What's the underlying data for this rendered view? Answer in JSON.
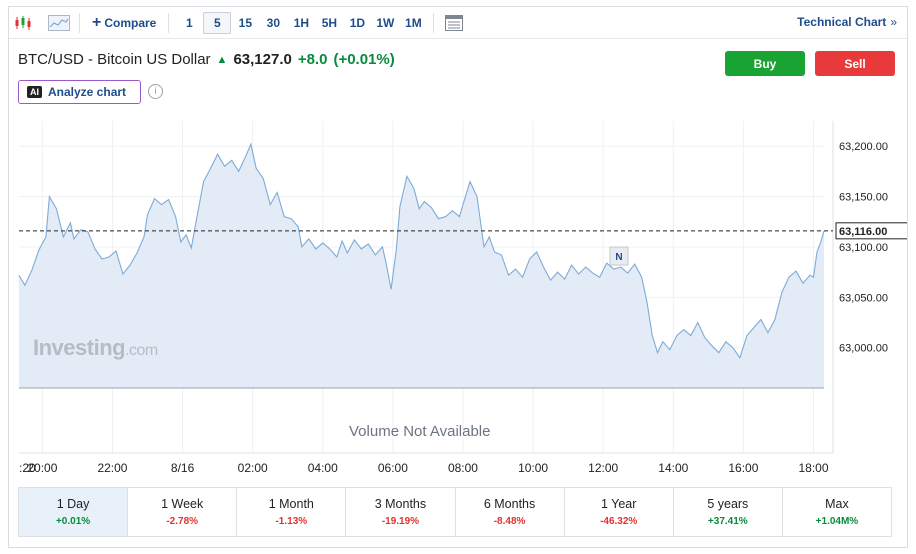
{
  "toolbar": {
    "compare_label": "Compare",
    "timeframes": [
      "1",
      "5",
      "15",
      "30",
      "1H",
      "5H",
      "1D",
      "1W",
      "1M"
    ],
    "active_timeframe": "5",
    "technical_chart_label": "Technical Chart",
    "technical_chart_chevron": "»"
  },
  "header": {
    "instrument": "BTC/USD - Bitcoin US Dollar",
    "price": "63,127.0",
    "change": "+8.0",
    "change_pct": "(+0.01%)",
    "direction_icon": "arrow-up-icon"
  },
  "buttons": {
    "buy": "Buy",
    "sell": "Sell"
  },
  "analyze": {
    "badge": "AI",
    "label": "Analyze chart",
    "info": "i"
  },
  "watermark": {
    "brand": "Investing",
    "suffix": ".com"
  },
  "volume_text": "Volume Not Available",
  "news_marker": "N",
  "colors": {
    "line": "#7eaad6",
    "area": "#e3ecf6",
    "positive": "#0a8a3c",
    "negative": "#e0322e",
    "buy": "#18a332",
    "sell": "#e83a3a"
  },
  "chart_data": {
    "type": "area",
    "x_tick_labels": [
      ":20",
      "20:00",
      "22:00",
      "8/16",
      "02:00",
      "04:00",
      "06:00",
      "08:00",
      "10:00",
      "12:00",
      "14:00",
      "16:00",
      "18:00"
    ],
    "y_tick_labels": [
      "63,200.00",
      "63,150.00",
      "63,100.00",
      "63,050.00",
      "63,000.00"
    ],
    "y_ticks": [
      63200,
      63150,
      63100,
      63050,
      63000
    ],
    "ylim": [
      62960,
      63225
    ],
    "x_range_hours": [
      19.333,
      42.3
    ],
    "current_value": 63116,
    "current_label": "63,116.00",
    "grid": true,
    "series": [
      {
        "values": [
          [
            19.33,
            63072
          ],
          [
            19.5,
            63062
          ],
          [
            19.7,
            63077
          ],
          [
            19.9,
            63097
          ],
          [
            20.1,
            63110
          ],
          [
            20.2,
            63150
          ],
          [
            20.4,
            63138
          ],
          [
            20.6,
            63110
          ],
          [
            20.8,
            63124
          ],
          [
            20.9,
            63108
          ],
          [
            21.1,
            63117
          ],
          [
            21.3,
            63115
          ],
          [
            21.5,
            63098
          ],
          [
            21.7,
            63088
          ],
          [
            21.9,
            63090
          ],
          [
            22.1,
            63096
          ],
          [
            22.3,
            63073
          ],
          [
            22.5,
            63082
          ],
          [
            22.7,
            63094
          ],
          [
            22.9,
            63110
          ],
          [
            23.0,
            63132
          ],
          [
            23.2,
            63148
          ],
          [
            23.4,
            63142
          ],
          [
            23.6,
            63147
          ],
          [
            23.8,
            63130
          ],
          [
            23.95,
            63105
          ],
          [
            24.1,
            63112
          ],
          [
            24.25,
            63099
          ],
          [
            24.4,
            63128
          ],
          [
            24.6,
            63165
          ],
          [
            24.8,
            63178
          ],
          [
            25.0,
            63192
          ],
          [
            25.2,
            63180
          ],
          [
            25.4,
            63186
          ],
          [
            25.6,
            63175
          ],
          [
            25.8,
            63190
          ],
          [
            25.95,
            63202
          ],
          [
            26.1,
            63178
          ],
          [
            26.3,
            63168
          ],
          [
            26.5,
            63142
          ],
          [
            26.7,
            63154
          ],
          [
            26.9,
            63130
          ],
          [
            27.1,
            63128
          ],
          [
            27.3,
            63120
          ],
          [
            27.4,
            63100
          ],
          [
            27.6,
            63108
          ],
          [
            27.8,
            63098
          ],
          [
            28.0,
            63104
          ],
          [
            28.2,
            63098
          ],
          [
            28.4,
            63090
          ],
          [
            28.55,
            63106
          ],
          [
            28.7,
            63094
          ],
          [
            28.9,
            63107
          ],
          [
            29.1,
            63098
          ],
          [
            29.3,
            63103
          ],
          [
            29.5,
            63092
          ],
          [
            29.7,
            63100
          ],
          [
            29.8,
            63085
          ],
          [
            29.95,
            63058
          ],
          [
            30.1,
            63098
          ],
          [
            30.2,
            63140
          ],
          [
            30.4,
            63170
          ],
          [
            30.6,
            63158
          ],
          [
            30.75,
            63138
          ],
          [
            30.9,
            63145
          ],
          [
            31.1,
            63139
          ],
          [
            31.3,
            63128
          ],
          [
            31.5,
            63130
          ],
          [
            31.7,
            63136
          ],
          [
            31.9,
            63130
          ],
          [
            32.0,
            63142
          ],
          [
            32.2,
            63165
          ],
          [
            32.4,
            63150
          ],
          [
            32.6,
            63100
          ],
          [
            32.75,
            63110
          ],
          [
            32.9,
            63095
          ],
          [
            33.1,
            63092
          ],
          [
            33.3,
            63072
          ],
          [
            33.5,
            63078
          ],
          [
            33.7,
            63070
          ],
          [
            33.9,
            63088
          ],
          [
            34.1,
            63095
          ],
          [
            34.3,
            63080
          ],
          [
            34.5,
            63067
          ],
          [
            34.7,
            63075
          ],
          [
            34.9,
            63068
          ],
          [
            35.1,
            63082
          ],
          [
            35.3,
            63073
          ],
          [
            35.5,
            63080
          ],
          [
            35.7,
            63074
          ],
          [
            35.9,
            63070
          ],
          [
            36.1,
            63084
          ],
          [
            36.3,
            63078
          ],
          [
            36.5,
            63080
          ],
          [
            36.7,
            63074
          ],
          [
            36.9,
            63083
          ],
          [
            37.1,
            63070
          ],
          [
            37.25,
            63045
          ],
          [
            37.4,
            63012
          ],
          [
            37.55,
            62995
          ],
          [
            37.7,
            63006
          ],
          [
            37.9,
            62998
          ],
          [
            38.1,
            63012
          ],
          [
            38.3,
            63018
          ],
          [
            38.5,
            63012
          ],
          [
            38.7,
            63025
          ],
          [
            38.9,
            63010
          ],
          [
            39.1,
            63002
          ],
          [
            39.3,
            62995
          ],
          [
            39.5,
            63006
          ],
          [
            39.7,
            63000
          ],
          [
            39.9,
            62990
          ],
          [
            40.1,
            63012
          ],
          [
            40.3,
            63020
          ],
          [
            40.5,
            63028
          ],
          [
            40.7,
            63015
          ],
          [
            40.9,
            63028
          ],
          [
            41.1,
            63055
          ],
          [
            41.3,
            63070
          ],
          [
            41.5,
            63076
          ],
          [
            41.7,
            63064
          ],
          [
            41.9,
            63072
          ],
          [
            42.0,
            63070
          ],
          [
            42.1,
            63095
          ],
          [
            42.2,
            63104
          ],
          [
            42.3,
            63116
          ]
        ]
      }
    ]
  }
}
